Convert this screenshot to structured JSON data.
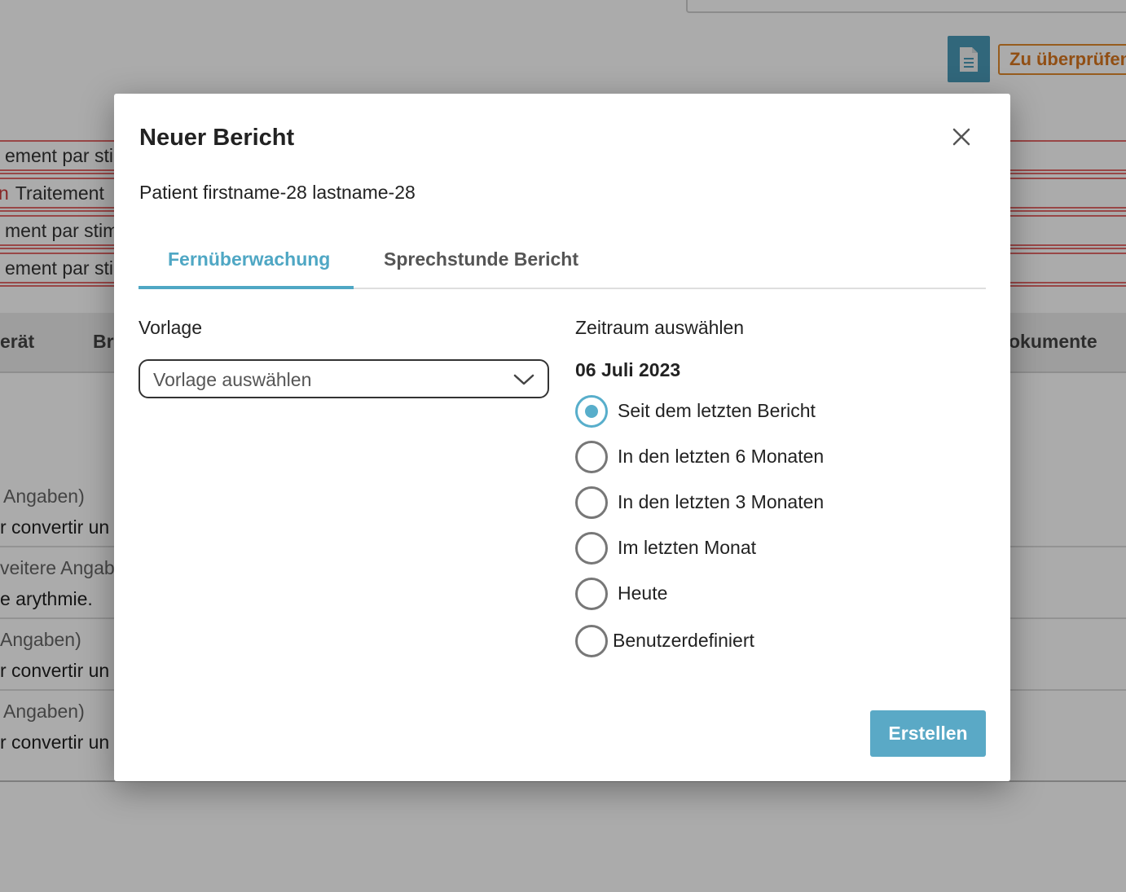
{
  "background": {
    "review_badge": "Zu überprüfen",
    "alerts": [
      {
        "prefix": "",
        "text": "ement par sti"
      },
      {
        "prefix": "n",
        "text": "Traitement"
      },
      {
        "prefix": "",
        "text": "ment par stim"
      },
      {
        "prefix": "",
        "text": "ement par sti"
      }
    ],
    "columns": [
      "erät",
      "Br",
      "okumente"
    ],
    "rows": [
      {
        "meta": " Angaben)",
        "text": "r convertir un"
      },
      {
        "meta": "veitere Angab",
        "text": "e arythmie."
      },
      {
        "meta": "Angaben)",
        "text": "r convertir un"
      },
      {
        "meta": " Angaben)",
        "text": "r convertir un"
      }
    ]
  },
  "modal": {
    "title": "Neuer Bericht",
    "patient": "Patient firstname-28 lastname-28",
    "tabs": [
      {
        "label": "Fernüberwachung",
        "active": true
      },
      {
        "label": "Sprechstunde Bericht",
        "active": false
      }
    ],
    "template": {
      "label": "Vorlage",
      "placeholder": "Vorlage auswählen"
    },
    "period": {
      "label": "Zeitraum auswählen",
      "date": "06 Juli 2023",
      "options": [
        {
          "label": "Seit dem letzten Bericht",
          "checked": true
        },
        {
          "label": "In den letzten 6 Monaten",
          "checked": false
        },
        {
          "label": "In den letzten 3 Monaten",
          "checked": false
        },
        {
          "label": "Im letzten Monat",
          "checked": false
        },
        {
          "label": "Heute",
          "checked": false
        },
        {
          "label": "Benutzerdefiniert",
          "checked": false
        }
      ]
    },
    "submit_label": "Erstellen"
  },
  "colors": {
    "accent": "#4fa7c4",
    "button": "#5aa9c6",
    "alert_border": "#e46a6a",
    "review_orange": "#e28a2e"
  },
  "icons": {
    "close": "close-icon",
    "chevron": "chevron-down-icon",
    "document": "document-icon"
  }
}
